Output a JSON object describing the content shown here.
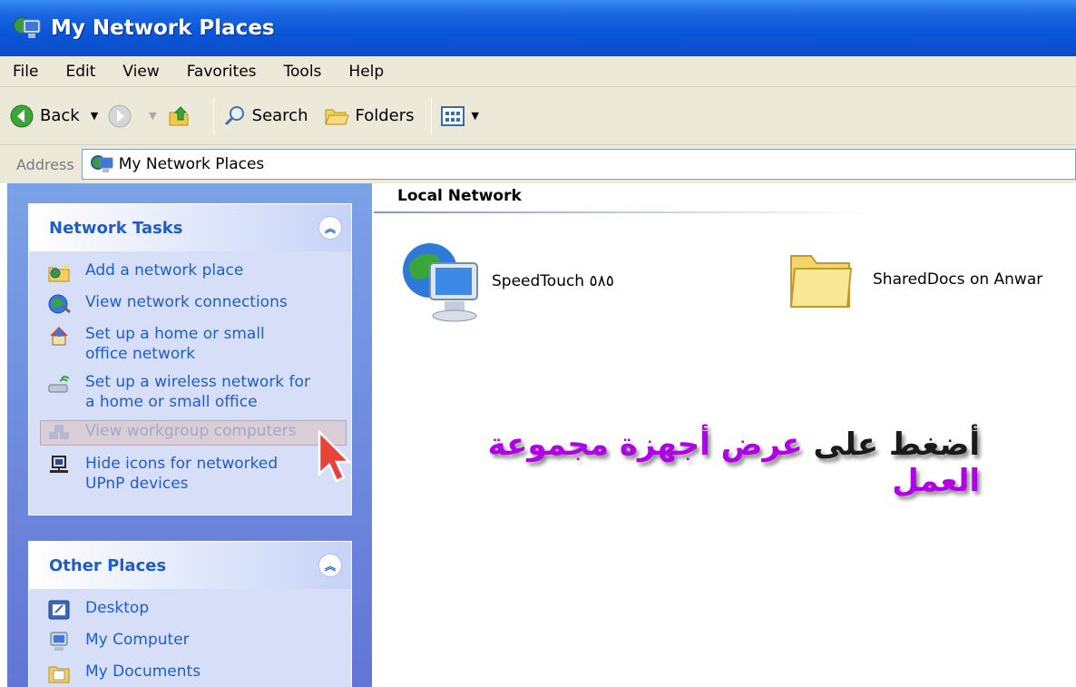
{
  "window": {
    "title": "My Network Places"
  },
  "menu": [
    "File",
    "Edit",
    "View",
    "Favorites",
    "Tools",
    "Help"
  ],
  "toolbar": {
    "back_label": "Back",
    "search_label": "Search",
    "folders_label": "Folders"
  },
  "address": {
    "label": "Address",
    "value": "My Network Places"
  },
  "network_tasks": {
    "title": "Network Tasks",
    "items": [
      {
        "label": "Add a network place",
        "icon": "add-network-place-icon"
      },
      {
        "label": "View network connections",
        "icon": "network-connections-icon"
      },
      {
        "label": "Set up a home or small office network",
        "icon": "home-network-icon"
      },
      {
        "label": "Set up a wireless network for a home or small office",
        "icon": "wireless-icon"
      },
      {
        "label": "View workgroup computers",
        "icon": "workgroup-icon",
        "state": "hover"
      },
      {
        "label": "Hide icons for networked UPnP devices",
        "icon": "upnp-icon"
      }
    ]
  },
  "other_places": {
    "title": "Other Places",
    "items": [
      {
        "label": "Desktop",
        "icon": "desktop-icon"
      },
      {
        "label": "My Computer",
        "icon": "my-computer-icon"
      },
      {
        "label": "My Documents",
        "icon": "my-documents-icon"
      }
    ]
  },
  "content": {
    "section_header": "Local Network",
    "items": [
      {
        "label": "SpeedTouch ٥٨٥",
        "icon": "network-computer-icon"
      },
      {
        "label": "SharedDocs on Anwar",
        "icon": "shared-folder-icon"
      }
    ]
  },
  "annotation": {
    "part1": "أضغط على",
    "part2": "عرض أجهزة مجموعة العمل",
    "colors": {
      "plain": "#1a1a1a",
      "accent": "#b000e8"
    }
  },
  "colors": {
    "titlebar": "#0a55d8",
    "taskpane": "#6f8fe0",
    "link": "#215dc6"
  }
}
